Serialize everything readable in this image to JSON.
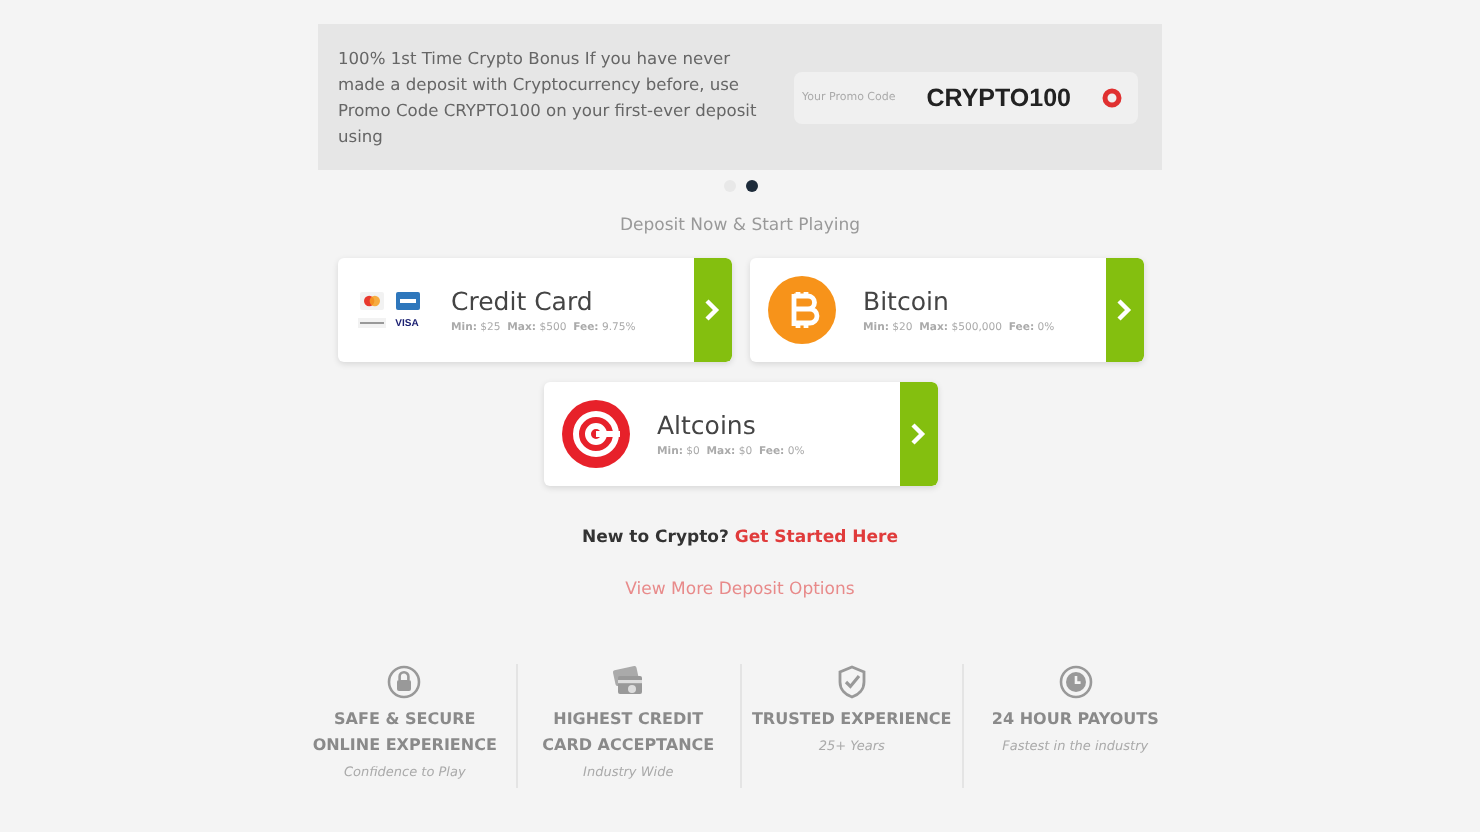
{
  "promo": {
    "text": "100% 1st Time Crypto Bonus If you have never made a deposit with Cryptocurrency before, use Promo Code CRYPTO100 on your first-ever deposit using",
    "placeholder": "Your Promo Code",
    "code": "CRYPTO100"
  },
  "slider_dots": [
    {
      "selected": false
    },
    {
      "selected": true
    }
  ],
  "heading": "Deposit Now & Start Playing",
  "methods": [
    {
      "kind": "cards",
      "name": "Credit Card",
      "details": "**Min:** $25  **Max:** $500  **Fee:** 9.75%",
      "card_label": "VISA"
    },
    {
      "kind": "bitcoin",
      "name": "Bitcoin",
      "details": "**Min:** $20  **Max:** $500,000  **Fee:** 0%"
    },
    {
      "kind": "altcoin",
      "name": "Altcoins",
      "details": "**Min:** $0  **Max:** $0  **Fee:** 0%"
    }
  ],
  "new_to_crypto": {
    "text": "New to Crypto?",
    "link": "Get Started Here"
  },
  "more_link": "View More Deposit Options",
  "features": [
    {
      "kind": "lock",
      "title": "SAFE & SECURE ONLINE EXPERIENCE",
      "subtitle": "Confidence to Play"
    },
    {
      "kind": "card",
      "title": "HIGHEST CREDIT CARD ACCEPTANCE",
      "subtitle": "Industry Wide"
    },
    {
      "kind": "shield",
      "title": "TRUSTED EXPERIENCE",
      "subtitle": "25+ Years"
    },
    {
      "kind": "clock",
      "title": "24 HOUR PAYOUTS",
      "subtitle": "Fastest in the industry"
    }
  ]
}
